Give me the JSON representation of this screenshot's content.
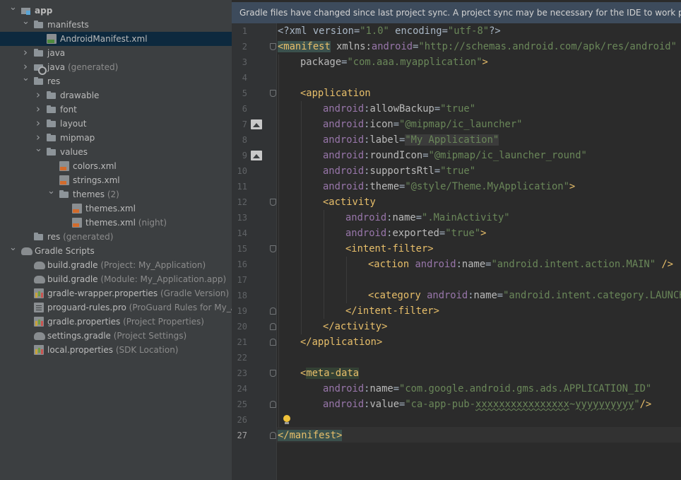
{
  "project_tree": [
    {
      "label": "app",
      "hint": "",
      "depth": 0,
      "arrow": "down",
      "icon": "app-module-icon",
      "bold": true
    },
    {
      "label": "manifests",
      "hint": "",
      "depth": 1,
      "arrow": "down",
      "icon": "folder-icon"
    },
    {
      "label": "AndroidManifest.xml",
      "hint": "",
      "depth": 2,
      "arrow": "",
      "icon": "manifest-file-icon",
      "selected": true
    },
    {
      "label": "java",
      "hint": "",
      "depth": 1,
      "arrow": "right",
      "icon": "folder-icon"
    },
    {
      "label": "java",
      "hint": "(generated)",
      "depth": 1,
      "arrow": "right",
      "icon": "generated-java-folder-icon"
    },
    {
      "label": "res",
      "hint": "",
      "depth": 1,
      "arrow": "down",
      "icon": "res-folder-icon"
    },
    {
      "label": "drawable",
      "hint": "",
      "depth": 2,
      "arrow": "right",
      "icon": "folder-icon"
    },
    {
      "label": "font",
      "hint": "",
      "depth": 2,
      "arrow": "right",
      "icon": "folder-icon"
    },
    {
      "label": "layout",
      "hint": "",
      "depth": 2,
      "arrow": "right",
      "icon": "folder-icon"
    },
    {
      "label": "mipmap",
      "hint": "",
      "depth": 2,
      "arrow": "right",
      "icon": "folder-icon"
    },
    {
      "label": "values",
      "hint": "",
      "depth": 2,
      "arrow": "down",
      "icon": "folder-icon"
    },
    {
      "label": "colors.xml",
      "hint": "",
      "depth": 3,
      "arrow": "",
      "icon": "xml-file-icon"
    },
    {
      "label": "strings.xml",
      "hint": "",
      "depth": 3,
      "arrow": "",
      "icon": "xml-file-icon"
    },
    {
      "label": "themes",
      "hint": "(2)",
      "depth": 3,
      "arrow": "down",
      "icon": "folder-icon"
    },
    {
      "label": "themes.xml",
      "hint": "",
      "depth": 4,
      "arrow": "",
      "icon": "xml-file-icon"
    },
    {
      "label": "themes.xml",
      "hint": "(night)",
      "depth": 4,
      "arrow": "",
      "icon": "xml-file-icon"
    },
    {
      "label": "res",
      "hint": "(generated)",
      "depth": 1,
      "arrow": "",
      "icon": "res-folder-icon"
    },
    {
      "label": "Gradle Scripts",
      "hint": "",
      "depth": 0,
      "arrow": "down",
      "icon": "gradle-icon"
    },
    {
      "label": "build.gradle",
      "hint": "(Project: My_Application)",
      "depth": 1,
      "arrow": "",
      "icon": "gradle-file-icon"
    },
    {
      "label": "build.gradle",
      "hint": "(Module: My_Application.app)",
      "depth": 1,
      "arrow": "",
      "icon": "gradle-file-icon"
    },
    {
      "label": "gradle-wrapper.properties",
      "hint": "(Gradle Version)",
      "depth": 1,
      "arrow": "",
      "icon": "properties-file-icon"
    },
    {
      "label": "proguard-rules.pro",
      "hint": "(ProGuard Rules for My_Appl",
      "depth": 1,
      "arrow": "",
      "icon": "proguard-file-icon"
    },
    {
      "label": "gradle.properties",
      "hint": "(Project Properties)",
      "depth": 1,
      "arrow": "",
      "icon": "properties-file-icon"
    },
    {
      "label": "settings.gradle",
      "hint": "(Project Settings)",
      "depth": 1,
      "arrow": "",
      "icon": "gradle-file-icon"
    },
    {
      "label": "local.properties",
      "hint": "(SDK Location)",
      "depth": 1,
      "arrow": "",
      "icon": "properties-file-icon"
    }
  ],
  "editor": {
    "banner": "Gradle files have changed since last project sync. A project sync may be necessary for the IDE to work properly.",
    "current_line": 27,
    "gutter_images": [
      7,
      9
    ],
    "fold_open": [
      2,
      5
    ],
    "fold_markers": [
      12,
      15,
      19,
      20,
      21,
      23,
      25,
      27
    ],
    "lines": [
      {
        "n": 1,
        "indent": 0,
        "tokens": [
          [
            "plain",
            "<?xml version="
          ],
          [
            "str",
            "\"1.0\""
          ],
          [
            "plain",
            " encoding="
          ],
          [
            "str",
            "\"utf-8\""
          ],
          [
            "plain",
            "?>"
          ]
        ]
      },
      {
        "n": 2,
        "indent": 0,
        "tokens": [
          [
            "taghl",
            "<manifest"
          ],
          [
            "plain",
            " "
          ],
          [
            "attr",
            "xmlns:"
          ],
          [
            "ns",
            "android"
          ],
          [
            "plain",
            "="
          ],
          [
            "str",
            "\"http://schemas.android.com/apk/res/android\""
          ]
        ]
      },
      {
        "n": 3,
        "indent": 1,
        "tokens": [
          [
            "attr",
            "package"
          ],
          [
            "plain",
            "="
          ],
          [
            "str",
            "\"com.aaa.myapplication\""
          ],
          [
            "tag",
            ">"
          ]
        ]
      },
      {
        "n": 4,
        "indent": 0,
        "tokens": []
      },
      {
        "n": 5,
        "indent": 1,
        "tokens": [
          [
            "tag",
            "<application"
          ]
        ]
      },
      {
        "n": 6,
        "indent": 2,
        "tokens": [
          [
            "ns",
            "android"
          ],
          [
            "plain",
            ":"
          ],
          [
            "attr",
            "allowBackup"
          ],
          [
            "plain",
            "="
          ],
          [
            "str",
            "\"true\""
          ]
        ]
      },
      {
        "n": 7,
        "indent": 2,
        "tokens": [
          [
            "ns",
            "android"
          ],
          [
            "plain",
            ":"
          ],
          [
            "attr",
            "icon"
          ],
          [
            "plain",
            "="
          ],
          [
            "str",
            "\"@mipmap/ic_launcher\""
          ]
        ]
      },
      {
        "n": 8,
        "indent": 2,
        "tokens": [
          [
            "ns",
            "android"
          ],
          [
            "plain",
            ":"
          ],
          [
            "attr",
            "label"
          ],
          [
            "plain",
            "="
          ],
          [
            "strsel",
            "\"My Application\""
          ]
        ]
      },
      {
        "n": 9,
        "indent": 2,
        "tokens": [
          [
            "ns",
            "android"
          ],
          [
            "plain",
            ":"
          ],
          [
            "attr",
            "roundIcon"
          ],
          [
            "plain",
            "="
          ],
          [
            "str",
            "\"@mipmap/ic_launcher_round\""
          ]
        ]
      },
      {
        "n": 10,
        "indent": 2,
        "tokens": [
          [
            "ns",
            "android"
          ],
          [
            "plain",
            ":"
          ],
          [
            "attr",
            "supportsRtl"
          ],
          [
            "plain",
            "="
          ],
          [
            "str",
            "\"true\""
          ]
        ]
      },
      {
        "n": 11,
        "indent": 2,
        "tokens": [
          [
            "ns",
            "android"
          ],
          [
            "plain",
            ":"
          ],
          [
            "attr",
            "theme"
          ],
          [
            "plain",
            "="
          ],
          [
            "str",
            "\"@style/Theme.MyApplication\""
          ],
          [
            "tag",
            ">"
          ]
        ]
      },
      {
        "n": 12,
        "indent": 2,
        "tokens": [
          [
            "tag",
            "<activity"
          ]
        ]
      },
      {
        "n": 13,
        "indent": 3,
        "tokens": [
          [
            "ns",
            "android"
          ],
          [
            "plain",
            ":"
          ],
          [
            "attr",
            "name"
          ],
          [
            "plain",
            "="
          ],
          [
            "str",
            "\".MainActivity\""
          ]
        ]
      },
      {
        "n": 14,
        "indent": 3,
        "tokens": [
          [
            "ns",
            "android"
          ],
          [
            "plain",
            ":"
          ],
          [
            "attr",
            "exported"
          ],
          [
            "plain",
            "="
          ],
          [
            "str",
            "\"true\""
          ],
          [
            "tag",
            ">"
          ]
        ]
      },
      {
        "n": 15,
        "indent": 3,
        "tokens": [
          [
            "tag",
            "<intent-filter>"
          ]
        ]
      },
      {
        "n": 16,
        "indent": 4,
        "tokens": [
          [
            "tag",
            "<action "
          ],
          [
            "ns",
            "android"
          ],
          [
            "plain",
            ":"
          ],
          [
            "attr",
            "name"
          ],
          [
            "plain",
            "="
          ],
          [
            "str",
            "\"android.intent.action.MAIN\""
          ],
          [
            "tag",
            " />"
          ]
        ]
      },
      {
        "n": 17,
        "indent": 0,
        "tokens": []
      },
      {
        "n": 18,
        "indent": 4,
        "tokens": [
          [
            "tag",
            "<category "
          ],
          [
            "ns",
            "android"
          ],
          [
            "plain",
            ":"
          ],
          [
            "attr",
            "name"
          ],
          [
            "plain",
            "="
          ],
          [
            "str",
            "\"android.intent.category.LAUNCHER"
          ]
        ]
      },
      {
        "n": 19,
        "indent": 3,
        "tokens": [
          [
            "tag",
            "</intent-filter>"
          ]
        ]
      },
      {
        "n": 20,
        "indent": 2,
        "tokens": [
          [
            "tag",
            "</activity>"
          ]
        ]
      },
      {
        "n": 21,
        "indent": 1,
        "tokens": [
          [
            "tag",
            "</application>"
          ]
        ]
      },
      {
        "n": 22,
        "indent": 0,
        "tokens": []
      },
      {
        "n": 23,
        "indent": 1,
        "tokens": [
          [
            "tag",
            "<"
          ],
          [
            "taghl2",
            "meta-data"
          ]
        ]
      },
      {
        "n": 24,
        "indent": 2,
        "tokens": [
          [
            "ns",
            "android"
          ],
          [
            "plain",
            ":"
          ],
          [
            "attr",
            "name"
          ],
          [
            "plain",
            "="
          ],
          [
            "str",
            "\"com.google.android.gms.ads.APPLICATION_ID\""
          ]
        ]
      },
      {
        "n": 25,
        "indent": 2,
        "tokens": [
          [
            "ns",
            "android"
          ],
          [
            "plain",
            ":"
          ],
          [
            "attr",
            "value"
          ],
          [
            "plain",
            "="
          ],
          [
            "str",
            "\"ca-app-pub-"
          ],
          [
            "strwavy",
            "xxxxxxxxxxxxxxxx"
          ],
          [
            "str",
            "~"
          ],
          [
            "strwavy",
            "yyyyyyyyyy"
          ],
          [
            "str",
            "\""
          ],
          [
            "tag",
            "/>"
          ]
        ]
      },
      {
        "n": 26,
        "indent": 0,
        "tokens": []
      },
      {
        "n": 27,
        "indent": 0,
        "tokens": [
          [
            "taghl",
            "</manifest>"
          ]
        ]
      }
    ]
  }
}
